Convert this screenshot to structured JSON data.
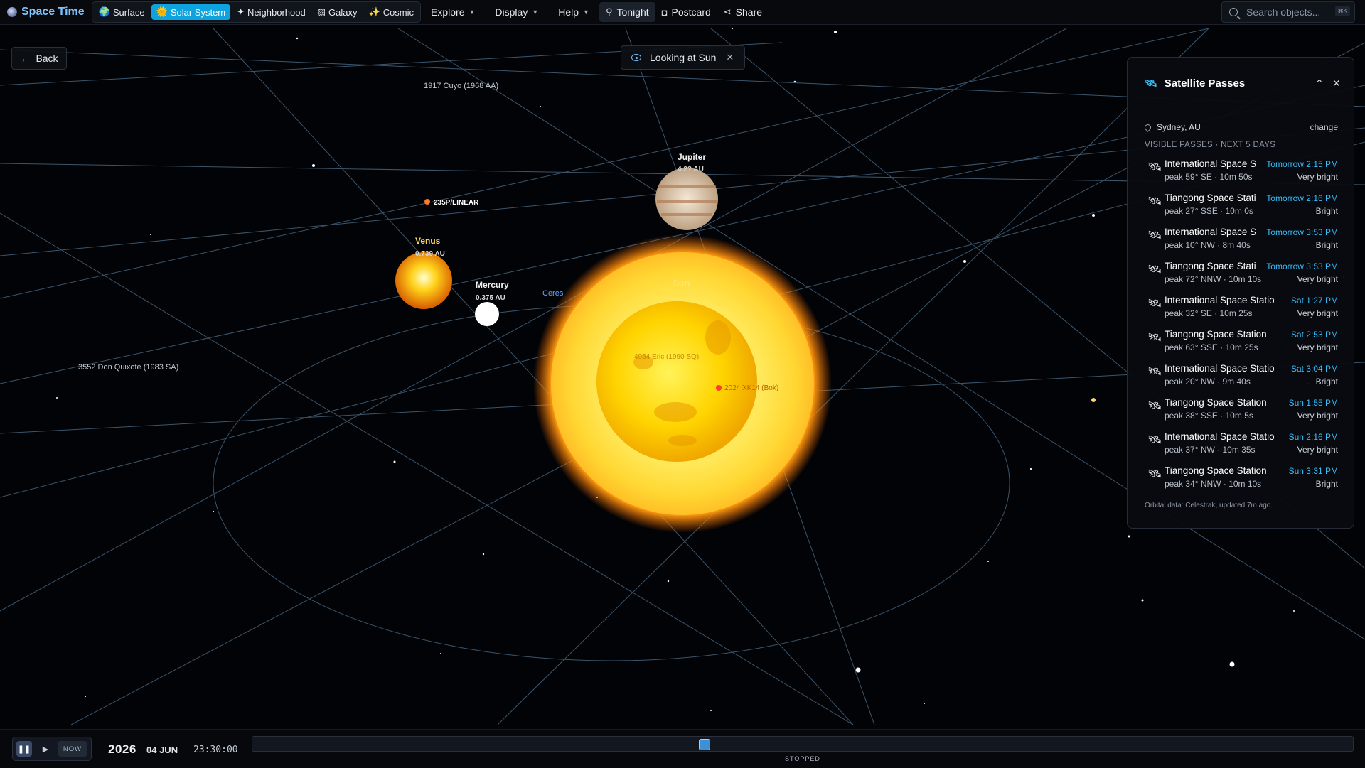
{
  "app": {
    "title": "Space Time"
  },
  "modes": [
    {
      "label": "Surface",
      "icon": "🌍"
    },
    {
      "label": "Solar System",
      "icon": "🌞",
      "active": true
    },
    {
      "label": "Neighborhood",
      "icon": "✦"
    },
    {
      "label": "Galaxy",
      "icon": "▨"
    },
    {
      "label": "Cosmic",
      "icon": "✨"
    }
  ],
  "menus": [
    "Explore",
    "Display",
    "Help"
  ],
  "toolbar": {
    "tonight": "Tonight",
    "postcard": "Postcard",
    "share": "Share"
  },
  "search": {
    "placeholder": "Search objects...",
    "shortcut": "⌘K"
  },
  "nav": {
    "back": "Back",
    "looking_at": "Looking at Sun"
  },
  "scene_labels": {
    "cuyo": "1917 Cuyo (1968 AA)",
    "linear": "235P/LINEAR",
    "jupiter": "Jupiter",
    "jupiter_dist": "4.2? AU",
    "venus": "Venus",
    "venus_dist": "0.739 AU",
    "mercury": "Mercury",
    "mercury_dist": "0.375 AU",
    "ceres": "Ceres",
    "sun": "Sun",
    "donquixote": "3552 Don Quixote (1983 SA)",
    "eros": "4954 Eric (1990 SQ)",
    "bok": "2024 XK14 (Bok)"
  },
  "panel": {
    "title": "Satellite Passes",
    "location": "Sydney, AU",
    "change": "change",
    "section": "VISIBLE PASSES · NEXT 5 DAYS",
    "footnote": "Orbital data: Celestrak, updated 7m ago.",
    "passes": [
      {
        "name": "International Space Station",
        "time": "Tomorrow 2:15 PM",
        "peak": "peak 59° SE  · 10m 50s",
        "brightness": "Very bright"
      },
      {
        "name": "Tiangong Space Station",
        "time": "Tomorrow 2:16 PM",
        "peak": "peak 27° SSE  · 10m 0s",
        "brightness": "Bright"
      },
      {
        "name": "International Space Station",
        "time": "Tomorrow 3:53 PM",
        "peak": "peak 10° NW  · 8m 40s",
        "brightness": "Bright"
      },
      {
        "name": "Tiangong Space Station",
        "time": "Tomorrow 3:53 PM",
        "peak": "peak 72° NNW  · 10m 10s",
        "brightness": "Very bright"
      },
      {
        "name": "International Space Station",
        "time": "Sat 1:27 PM",
        "peak": "peak 32° SE  · 10m 25s",
        "brightness": "Very bright"
      },
      {
        "name": "Tiangong Space Station",
        "time": "Sat 2:53 PM",
        "peak": "peak 63° SSE  · 10m 25s",
        "brightness": "Very bright"
      },
      {
        "name": "International Space Station",
        "time": "Sat 3:04 PM",
        "peak": "peak 20° NW  · 9m 40s",
        "brightness": "Bright"
      },
      {
        "name": "Tiangong Space Station",
        "time": "Sun 1:55 PM",
        "peak": "peak 38° SSE  · 10m 5s",
        "brightness": "Very bright"
      },
      {
        "name": "International Space Station",
        "time": "Sun 2:16 PM",
        "peak": "peak 37° NW  · 10m 35s",
        "brightness": "Very bright"
      },
      {
        "name": "Tiangong Space Station",
        "time": "Sun 3:31 PM",
        "peak": "peak 34° NNW  · 10m 10s",
        "brightness": "Bright"
      }
    ]
  },
  "time": {
    "now": "NOW",
    "year": "2026",
    "date": "04 JUN",
    "clock": "23:30:00",
    "status": "STOPPED",
    "position": 0.41
  }
}
